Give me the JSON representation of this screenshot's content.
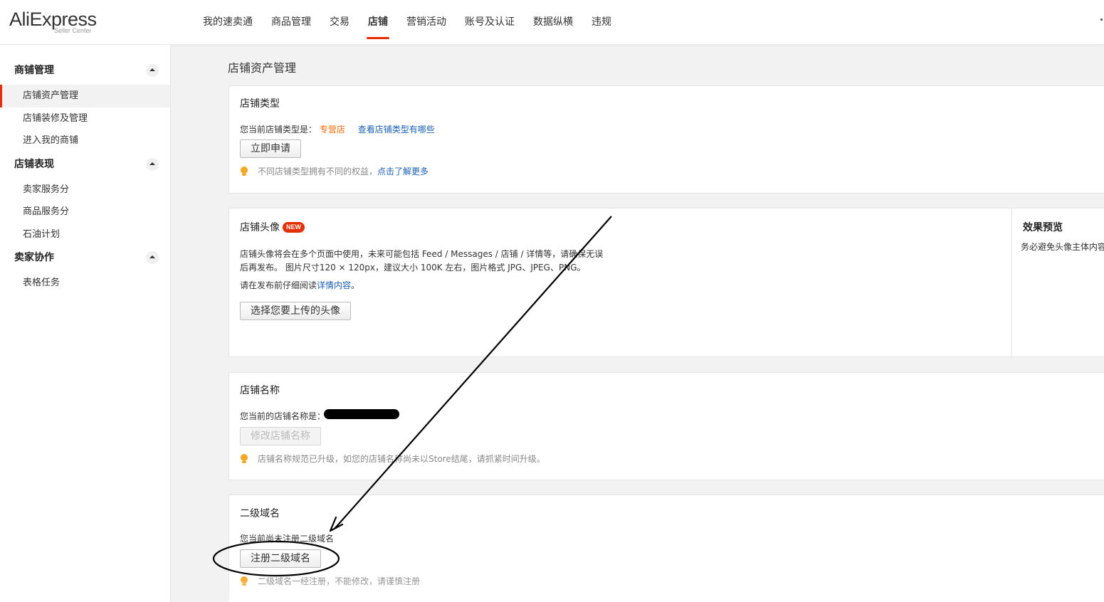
{
  "header": {
    "logo_main": "AliExpress",
    "logo_sub": "Seller Center",
    "nav": [
      {
        "label": "我的速卖通"
      },
      {
        "label": "商品管理"
      },
      {
        "label": "交易"
      },
      {
        "label": "店铺",
        "active": true
      },
      {
        "label": "营销活动"
      },
      {
        "label": "账号及认证"
      },
      {
        "label": "数据纵横"
      },
      {
        "label": "违规"
      }
    ]
  },
  "sidebar": {
    "groups": [
      {
        "title": "商铺管理",
        "items": [
          "店铺资产管理",
          "店铺装修及管理",
          "进入我的商铺"
        ]
      },
      {
        "title": "店铺表现",
        "items": [
          "卖家服务分",
          "商品服务分",
          "石油计划"
        ]
      },
      {
        "title": "卖家协作",
        "items": [
          "表格任务"
        ]
      }
    ],
    "active_item": "店铺资产管理"
  },
  "main": {
    "page_title": "店铺资产管理",
    "store_type": {
      "title": "店铺类型",
      "label": "您当前店铺类型是：",
      "value": "专营店",
      "link": "查看店铺类型有哪些",
      "button": "立即申请",
      "hint_text": "不同店铺类型拥有不同的权益，",
      "hint_link": "点击了解更多"
    },
    "avatar": {
      "title": "店铺头像",
      "badge": "NEW",
      "desc_line1": "店铺头像将会在多个页面中使用，未来可能包括 Feed / Messages / 店铺 / 详情等，请确保无误",
      "desc_line2": "后再发布。 图片尺寸120 × 120px，建议大小 100K 左右，图片格式 JPG、JPEG、PNG。",
      "read_prefix": "请在发布前仔细阅读",
      "read_link": "详情内容",
      "read_suffix": "。",
      "button": "选择您要上传的头像",
      "preview_title": "效果预览",
      "preview_text": "务必避免头像主体内容"
    },
    "store_name": {
      "title": "店铺名称",
      "label": "您当前的店铺名称是：",
      "button": "修改店铺名称",
      "hint_text": "店铺名称规范已升级，如您的店铺名称尚未以Store结尾，请抓紧时间升级。"
    },
    "subdomain": {
      "title": "二级域名",
      "status": "您当前尚未注册二级域名",
      "button": "注册二级域名",
      "hint_text": "二级域名一经注册，不能修改，请谨慎注册"
    }
  },
  "colors": {
    "brand": "#e62e04",
    "link": "#1a5fb4",
    "store_type_value": "#ff6600",
    "hint_icon": "#f5a623"
  }
}
